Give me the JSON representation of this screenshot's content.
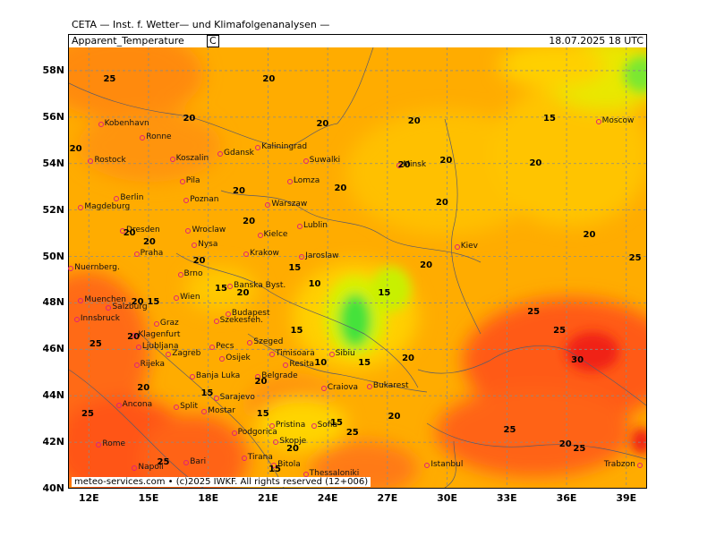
{
  "header": {
    "title": "CETA — Inst. f. Wetter— und Klimafolgenanalysen —",
    "parameter": "Apparent_Temperature",
    "unit": "C",
    "valid_time": "18.07.2025  18 UTC"
  },
  "footer": "meteo-services.com • (c)2025 IWKF. All rights reserved (12+006)",
  "axes": {
    "lat_labels": [
      "58N",
      "56N",
      "54N",
      "52N",
      "50N",
      "48N",
      "46N",
      "44N",
      "42N",
      "40N"
    ],
    "lon_labels": [
      "12E",
      "15E",
      "18E",
      "21E",
      "24E",
      "27E",
      "30E",
      "33E",
      "36E",
      "39E"
    ]
  },
  "colors": {
    "cool_green": "#44e23a",
    "yellow_green": "#d8f000",
    "yellow": "#ffd800",
    "orange": "#ffac00",
    "dark_orange": "#ff7a10",
    "red": "#f02018",
    "city_marker": "#e0207a",
    "grid": "#8a8a8a"
  },
  "cities": [
    {
      "name": "Kobenhavn",
      "lon": 12.6,
      "lat": 55.7
    },
    {
      "name": "Ronne",
      "lon": 14.7,
      "lat": 55.1
    },
    {
      "name": "Rostock",
      "lon": 12.1,
      "lat": 54.1
    },
    {
      "name": "Koszalin",
      "lon": 16.2,
      "lat": 54.2
    },
    {
      "name": "Gdansk",
      "lon": 18.6,
      "lat": 54.4
    },
    {
      "name": "Kaliningrad",
      "lon": 20.5,
      "lat": 54.7
    },
    {
      "name": "Suwalki",
      "lon": 22.9,
      "lat": 54.1
    },
    {
      "name": "Minsk",
      "lon": 27.6,
      "lat": 53.9
    },
    {
      "name": "Moscow",
      "lon": 37.6,
      "lat": 55.8
    },
    {
      "name": "Pila",
      "lon": 16.7,
      "lat": 53.2
    },
    {
      "name": "Lomza",
      "lon": 22.1,
      "lat": 53.2
    },
    {
      "name": "Berlin",
      "lon": 13.4,
      "lat": 52.5
    },
    {
      "name": "Poznan",
      "lon": 16.9,
      "lat": 52.4
    },
    {
      "name": "Warszaw",
      "lon": 21.0,
      "lat": 52.2
    },
    {
      "name": "Magdeburg",
      "lon": 11.6,
      "lat": 52.1
    },
    {
      "name": "Lublin",
      "lon": 22.6,
      "lat": 51.3
    },
    {
      "name": "Dresden",
      "lon": 13.7,
      "lat": 51.1
    },
    {
      "name": "Wroclaw",
      "lon": 17.0,
      "lat": 51.1
    },
    {
      "name": "Kielce",
      "lon": 20.6,
      "lat": 50.9
    },
    {
      "name": "Nysa",
      "lon": 17.3,
      "lat": 50.5
    },
    {
      "name": "Kiev",
      "lon": 30.5,
      "lat": 50.4
    },
    {
      "name": "Praha",
      "lon": 14.4,
      "lat": 50.1
    },
    {
      "name": "Krakow",
      "lon": 19.9,
      "lat": 50.1
    },
    {
      "name": "Jaroslaw",
      "lon": 22.7,
      "lat": 50.0
    },
    {
      "name": "Nuernberg.",
      "lon": 11.1,
      "lat": 49.5
    },
    {
      "name": "Brno",
      "lon": 16.6,
      "lat": 49.2
    },
    {
      "name": "Banska Byst.",
      "lon": 19.1,
      "lat": 48.7
    },
    {
      "name": "Muenchen",
      "lon": 11.6,
      "lat": 48.1
    },
    {
      "name": "Wien",
      "lon": 16.4,
      "lat": 48.2
    },
    {
      "name": "Salzburg",
      "lon": 13.0,
      "lat": 47.8
    },
    {
      "name": "Budapest",
      "lon": 19.0,
      "lat": 47.5
    },
    {
      "name": "Szekesfeh.",
      "lon": 18.4,
      "lat": 47.2
    },
    {
      "name": "Innsbruck",
      "lon": 11.4,
      "lat": 47.3
    },
    {
      "name": "Graz",
      "lon": 15.4,
      "lat": 47.1
    },
    {
      "name": "Szeged",
      "lon": 20.1,
      "lat": 46.3
    },
    {
      "name": "Klagenfurt",
      "lon": 14.3,
      "lat": 46.6
    },
    {
      "name": "Ljubljana",
      "lon": 14.5,
      "lat": 46.1
    },
    {
      "name": "Pecs",
      "lon": 18.2,
      "lat": 46.1
    },
    {
      "name": "Sibiu",
      "lon": 24.2,
      "lat": 45.8
    },
    {
      "name": "Zagreb",
      "lon": 16.0,
      "lat": 45.8
    },
    {
      "name": "Rijeka",
      "lon": 14.4,
      "lat": 45.3
    },
    {
      "name": "Osijek",
      "lon": 18.7,
      "lat": 45.6
    },
    {
      "name": "Timisoara",
      "lon": 21.2,
      "lat": 45.8
    },
    {
      "name": "Resita",
      "lon": 21.9,
      "lat": 45.3
    },
    {
      "name": "Banja Luka",
      "lon": 17.2,
      "lat": 44.8
    },
    {
      "name": "Belgrade",
      "lon": 20.5,
      "lat": 44.8
    },
    {
      "name": "Bukarest",
      "lon": 26.1,
      "lat": 44.4
    },
    {
      "name": "Craiova",
      "lon": 23.8,
      "lat": 44.3
    },
    {
      "name": "Ancona",
      "lon": 13.5,
      "lat": 43.6
    },
    {
      "name": "Split",
      "lon": 16.4,
      "lat": 43.5
    },
    {
      "name": "Sarajevo",
      "lon": 18.4,
      "lat": 43.9
    },
    {
      "name": "Mostar",
      "lon": 17.8,
      "lat": 43.3
    },
    {
      "name": "Pristina",
      "lon": 21.2,
      "lat": 42.7
    },
    {
      "name": "Sofia",
      "lon": 23.3,
      "lat": 42.7
    },
    {
      "name": "Podgorica",
      "lon": 19.3,
      "lat": 42.4
    },
    {
      "name": "Rome",
      "lon": 12.5,
      "lat": 41.9
    },
    {
      "name": "Tirana",
      "lon": 19.8,
      "lat": 41.3
    },
    {
      "name": "Skopje",
      "lon": 21.4,
      "lat": 42.0
    },
    {
      "name": "Napoli",
      "lon": 14.3,
      "lat": 40.9
    },
    {
      "name": "Bari",
      "lon": 16.9,
      "lat": 41.1
    },
    {
      "name": "Bitola",
      "lon": 21.3,
      "lat": 41.0
    },
    {
      "name": "Thessaloniki",
      "lon": 22.9,
      "lat": 40.6
    },
    {
      "name": "Istanbul",
      "lon": 29.0,
      "lat": 41.0
    },
    {
      "name": "Trabzon",
      "lon": 39.7,
      "lat": 41.0
    }
  ],
  "isoline_values": [
    {
      "v": "25",
      "lon": 13.0,
      "lat": 57.6
    },
    {
      "v": "20",
      "lon": 21.0,
      "lat": 57.6
    },
    {
      "v": "20",
      "lon": 17.0,
      "lat": 55.9
    },
    {
      "v": "20",
      "lon": 23.7,
      "lat": 55.7
    },
    {
      "v": "20",
      "lon": 28.3,
      "lat": 55.8
    },
    {
      "v": "15",
      "lon": 35.1,
      "lat": 55.9
    },
    {
      "v": "20",
      "lon": 11.3,
      "lat": 54.6
    },
    {
      "v": "20",
      "lon": 27.8,
      "lat": 53.9
    },
    {
      "v": "20",
      "lon": 29.9,
      "lat": 54.1
    },
    {
      "v": "20",
      "lon": 34.4,
      "lat": 54.0
    },
    {
      "v": "20",
      "lon": 19.5,
      "lat": 52.8
    },
    {
      "v": "20",
      "lon": 24.6,
      "lat": 52.9
    },
    {
      "v": "20",
      "lon": 29.7,
      "lat": 52.3
    },
    {
      "v": "20",
      "lon": 20.0,
      "lat": 51.5
    },
    {
      "v": "20",
      "lon": 14.0,
      "lat": 51.0
    },
    {
      "v": "20",
      "lon": 15.0,
      "lat": 50.6
    },
    {
      "v": "20",
      "lon": 37.1,
      "lat": 50.9
    },
    {
      "v": "20",
      "lon": 17.5,
      "lat": 49.8
    },
    {
      "v": "25",
      "lon": 39.4,
      "lat": 49.9
    },
    {
      "v": "20",
      "lon": 28.9,
      "lat": 49.6
    },
    {
      "v": "15",
      "lon": 22.3,
      "lat": 49.5
    },
    {
      "v": "10",
      "lon": 23.3,
      "lat": 48.8
    },
    {
      "v": "15",
      "lon": 26.8,
      "lat": 48.4
    },
    {
      "v": "15",
      "lon": 18.6,
      "lat": 48.6
    },
    {
      "v": "20",
      "lon": 19.7,
      "lat": 48.4
    },
    {
      "v": "20",
      "lon": 14.4,
      "lat": 48.0
    },
    {
      "v": "15",
      "lon": 15.2,
      "lat": 48.0
    },
    {
      "v": "25",
      "lon": 34.3,
      "lat": 47.6
    },
    {
      "v": "15",
      "lon": 22.4,
      "lat": 46.8
    },
    {
      "v": "25",
      "lon": 35.6,
      "lat": 46.8
    },
    {
      "v": "20",
      "lon": 14.2,
      "lat": 46.5
    },
    {
      "v": "25",
      "lon": 12.3,
      "lat": 46.2
    },
    {
      "v": "30",
      "lon": 36.5,
      "lat": 45.5
    },
    {
      "v": "10",
      "lon": 23.6,
      "lat": 45.4
    },
    {
      "v": "15",
      "lon": 25.8,
      "lat": 45.4
    },
    {
      "v": "20",
      "lon": 28.0,
      "lat": 45.6
    },
    {
      "v": "20",
      "lon": 20.6,
      "lat": 44.6
    },
    {
      "v": "20",
      "lon": 14.7,
      "lat": 44.3
    },
    {
      "v": "15",
      "lon": 17.9,
      "lat": 44.1
    },
    {
      "v": "25",
      "lon": 11.9,
      "lat": 43.2
    },
    {
      "v": "15",
      "lon": 20.7,
      "lat": 43.2
    },
    {
      "v": "20",
      "lon": 27.3,
      "lat": 43.1
    },
    {
      "v": "15",
      "lon": 24.4,
      "lat": 42.8
    },
    {
      "v": "25",
      "lon": 25.2,
      "lat": 42.4
    },
    {
      "v": "25",
      "lon": 33.1,
      "lat": 42.5
    },
    {
      "v": "20",
      "lon": 22.2,
      "lat": 41.7
    },
    {
      "v": "20",
      "lon": 35.9,
      "lat": 41.9
    },
    {
      "v": "25",
      "lon": 36.6,
      "lat": 41.7
    },
    {
      "v": "25",
      "lon": 15.7,
      "lat": 41.1
    },
    {
      "v": "15",
      "lon": 21.3,
      "lat": 40.8
    }
  ]
}
